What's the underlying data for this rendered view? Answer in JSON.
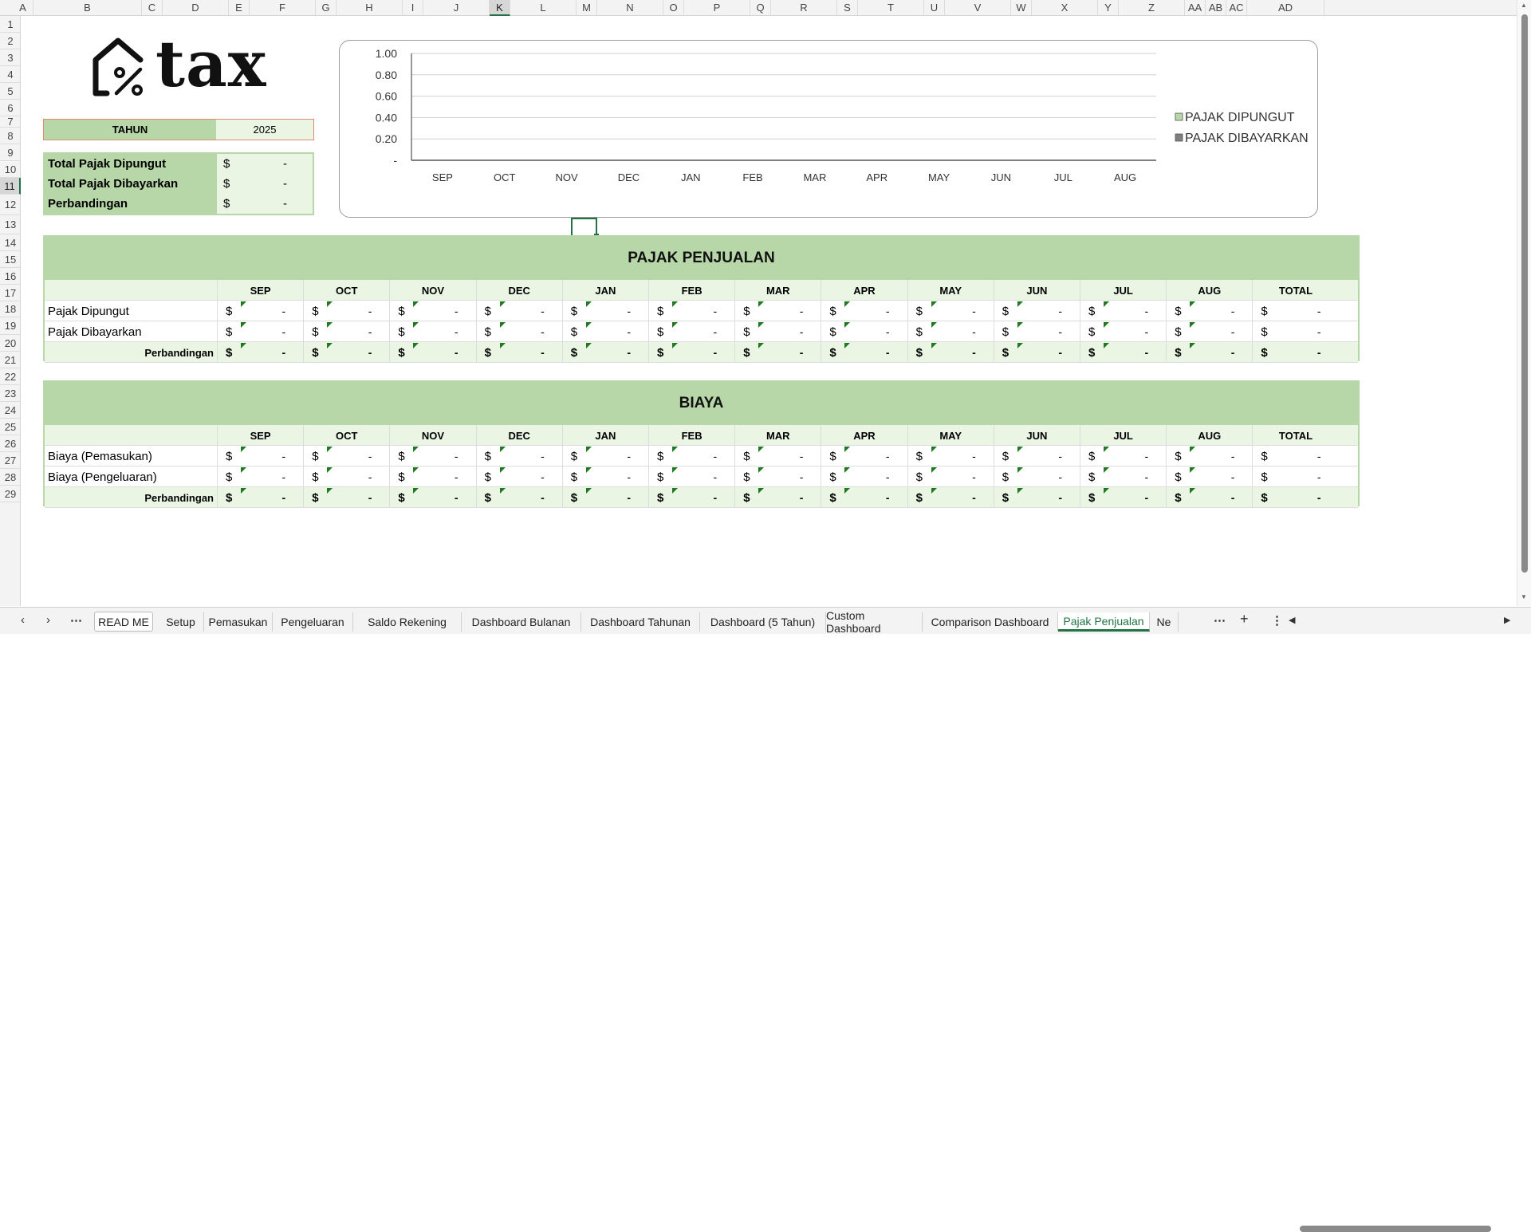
{
  "columns": [
    "A",
    "B",
    "C",
    "D",
    "E",
    "F",
    "G",
    "H",
    "I",
    "J",
    "K",
    "L",
    "M",
    "N",
    "O",
    "P",
    "Q",
    "R",
    "S",
    "T",
    "U",
    "V",
    "W",
    "X",
    "Y",
    "Z",
    "AA",
    "AB",
    "AC",
    "AD"
  ],
  "selected_column": "K",
  "rows": [
    "1",
    "2",
    "3",
    "4",
    "5",
    "6",
    "7",
    "8",
    "9",
    "10",
    "11",
    "12",
    "13",
    "14",
    "15",
    "16",
    "17",
    "18",
    "19",
    "20",
    "21",
    "22",
    "23",
    "24",
    "25",
    "26",
    "27",
    "28",
    "29"
  ],
  "selected_row": "11",
  "logo": {
    "text": "tax",
    "icon": "house-percent-icon"
  },
  "year": {
    "label": "TAHUN",
    "value": "2025"
  },
  "summary": [
    {
      "label": "Total Pajak Dipungut",
      "currency": "$",
      "value": "-"
    },
    {
      "label": "Total Pajak Dibayarkan",
      "currency": "$",
      "value": "-"
    },
    {
      "label": "Perbandingan",
      "currency": "$",
      "value": "-"
    }
  ],
  "chart_data": {
    "type": "bar",
    "categories": [
      "SEP",
      "OCT",
      "NOV",
      "DEC",
      "JAN",
      "FEB",
      "MAR",
      "APR",
      "MAY",
      "JUN",
      "JUL",
      "AUG"
    ],
    "series": [
      {
        "name": "PAJAK DIPUNGUT",
        "values": [
          0,
          0,
          0,
          0,
          0,
          0,
          0,
          0,
          0,
          0,
          0,
          0
        ],
        "color": "#b7d7a8"
      },
      {
        "name": "PAJAK DIBAYARKAN",
        "values": [
          0,
          0,
          0,
          0,
          0,
          0,
          0,
          0,
          0,
          0,
          0,
          0
        ],
        "color": "#7f7f7f"
      }
    ],
    "ylim": [
      0,
      1
    ],
    "yticks": [
      "1.00",
      "0.80",
      "0.60",
      "0.40",
      "0.20",
      "-"
    ],
    "grid": true,
    "legend": "right"
  },
  "months": [
    "SEP",
    "OCT",
    "NOV",
    "DEC",
    "JAN",
    "FEB",
    "MAR",
    "APR",
    "MAY",
    "JUN",
    "JUL",
    "AUG",
    "TOTAL"
  ],
  "currency": "$",
  "empty": "-",
  "sales_tax": {
    "title": "PAJAK PENJUALAN",
    "rows": [
      {
        "label": "Pajak Dipungut"
      },
      {
        "label": "Pajak Dibayarkan"
      }
    ],
    "total_label": "Perbandingan"
  },
  "costs": {
    "title": "BIAYA",
    "rows": [
      {
        "label": "Biaya (Pemasukan)"
      },
      {
        "label": "Biaya (Pengeluaran)"
      }
    ],
    "total_label": "Perbandingan"
  },
  "tabs": [
    "READ ME",
    "Setup",
    "Pemasukan",
    "Pengeluaran",
    "Saldo Rekening",
    "Dashboard Bulanan",
    "Dashboard Tahunan",
    "Dashboard (5 Tahun)",
    "Custom Dashboard",
    "Comparison Dashboard",
    "Pajak Penjualan",
    "Ne"
  ],
  "active_tab": "Pajak Penjualan",
  "colors": {
    "header_green": "#b7d7a8",
    "light_green": "#eaf5e3",
    "accent": "#217346"
  }
}
